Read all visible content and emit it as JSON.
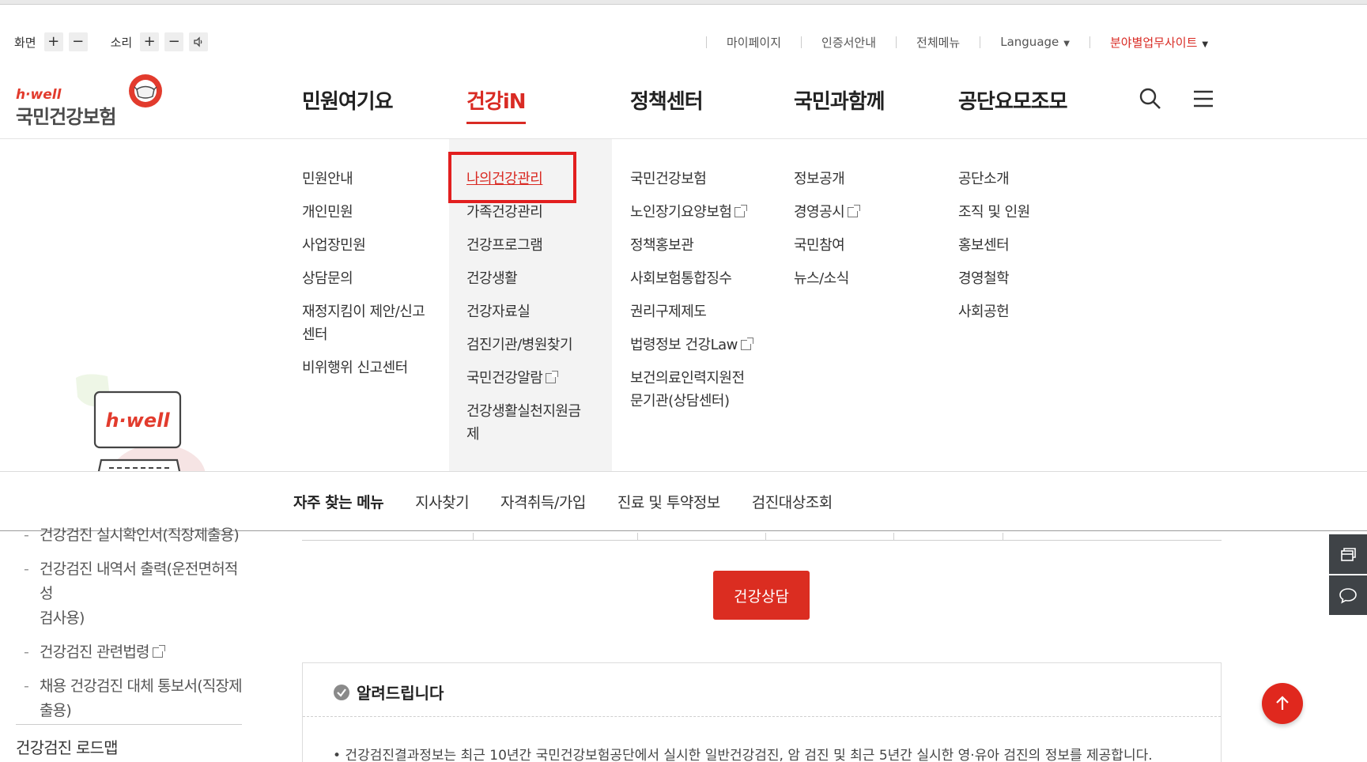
{
  "accessibility": {
    "screen_label": "화면",
    "sound_label": "소리",
    "plus": "+",
    "minus": "−"
  },
  "utility_links": [
    {
      "label": "마이페이지"
    },
    {
      "label": "인증서안내"
    },
    {
      "label": "전체메뉴"
    },
    {
      "label": "Language"
    },
    {
      "label": "분야별업무사이트"
    }
  ],
  "logo": {
    "tagline": "h·well",
    "name": "국민건강보험",
    "brand_color": "#e23b2d"
  },
  "gnb": [
    {
      "label": "민원여기요"
    },
    {
      "label": "건강iN"
    },
    {
      "label": "정책센터"
    },
    {
      "label": "국민과함께"
    },
    {
      "label": "공단요모조모"
    }
  ],
  "gnb_icons": [
    "search-icon",
    "hamburger-menu-icon"
  ],
  "mega": {
    "illustration_text": "h·well",
    "col1": [
      "민원안내",
      "개인민원",
      "사업장민원",
      "상담문의",
      "재정지킴이 제안/신고\n센터",
      "비위행위 신고센터"
    ],
    "col2": [
      "나의건강관리",
      "가족건강관리",
      "건강프로그램",
      "건강생활",
      "건강자료실",
      "검진기관/병원찾기",
      "국민건강알람",
      "건강생활실천지원금\n제"
    ],
    "col3": [
      "국민건강보험",
      "노인장기요양보험",
      "정책홍보관",
      "사회보험통합징수",
      "권리구제제도",
      "법령정보 건강Law",
      "보건의료인력지원전\n문기관(상담센터)"
    ],
    "col4": [
      "정보공개",
      "경영공시",
      "국민참여",
      "뉴스/소식"
    ],
    "col5": [
      "공단소개",
      "조직 및 인원",
      "홍보센터",
      "경영철학",
      "사회공헌"
    ]
  },
  "frequent": {
    "title": "자주 찾는 메뉴",
    "items": [
      "지사찾기",
      "자격취득/가입",
      "진료 및 투약정보",
      "검진대상조회"
    ]
  },
  "sidebar": {
    "items": [
      "건강검진 실시확인서(직장제출용)",
      "건강검진 내역서 출력(운전면허적성\n검사용)",
      "건강검진 관련법령",
      "채용 건강검진 대체 통보서(직장제\n출용)"
    ],
    "roadmap": "건강검진 로드맵"
  },
  "content": {
    "consult_button": "건강상담",
    "notice_title": "알려드립니다",
    "notice_text": "• 건강검진결과정보는 최근 10년간 국민건강보험공단에서 실시한 일반건강검진, 암 검진 및 최근 5년간 실시한 영·유아 검진의 정보를 제공합니다."
  },
  "colors": {
    "accent": "#d92b24",
    "highlight_box": "#e21f1f",
    "float_btn": "#3f4347"
  }
}
